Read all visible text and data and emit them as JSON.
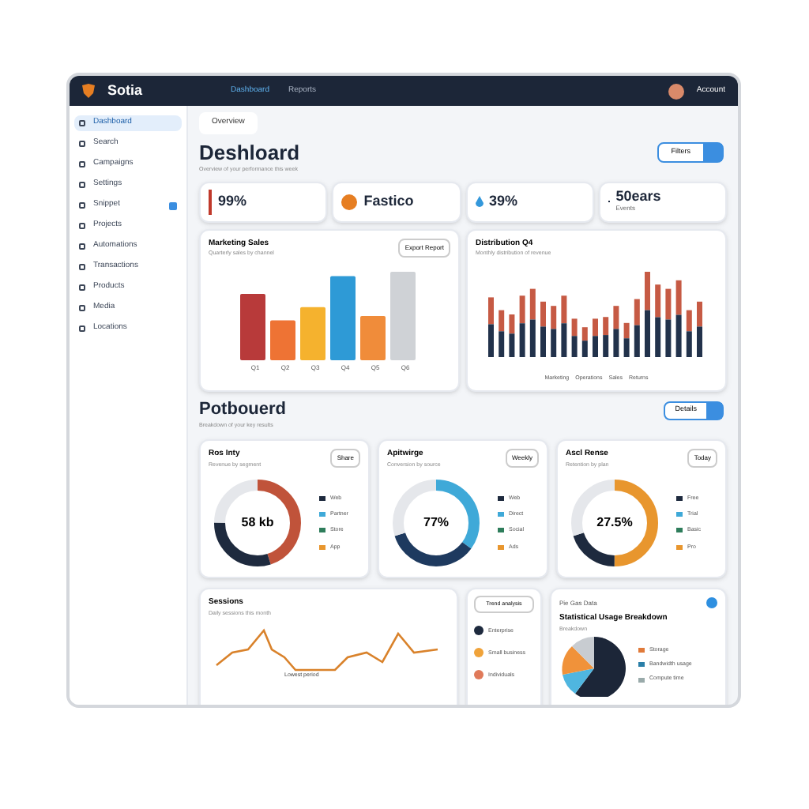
{
  "app": {
    "name": "Sotia"
  },
  "topnav": [
    {
      "label": "Dashboard",
      "selected": true
    },
    {
      "label": "Reports",
      "selected": false
    }
  ],
  "user": {
    "label": "Account"
  },
  "sidebar": {
    "items": [
      {
        "label": "Dashboard",
        "selected": true,
        "badge": false
      },
      {
        "label": "Search",
        "selected": false,
        "badge": false
      },
      {
        "label": "Campaigns",
        "selected": false,
        "badge": false
      },
      {
        "label": "Settings",
        "selected": false,
        "badge": false
      },
      {
        "label": "Snippet",
        "selected": false,
        "badge": true
      },
      {
        "label": "Projects",
        "selected": false,
        "badge": false
      },
      {
        "label": "Automations",
        "selected": false,
        "badge": false
      },
      {
        "label": "Transactions",
        "selected": false,
        "badge": false
      },
      {
        "label": "Products",
        "selected": false,
        "badge": false
      },
      {
        "label": "Media",
        "selected": false,
        "badge": false
      },
      {
        "label": "Locations",
        "selected": false,
        "badge": false
      }
    ]
  },
  "breadcrumb": "Overview",
  "header": {
    "title": "Deshloard",
    "subtitle": "Overview of your performance this week",
    "button": "Filters"
  },
  "stats": [
    {
      "value": "99%",
      "kind": "bar",
      "color": "#c0392b"
    },
    {
      "value": "Fastico",
      "kind": "logo",
      "color": "#e67e22"
    },
    {
      "value": "39%",
      "kind": "drop",
      "color": "#3498db"
    },
    {
      "value": "50ears",
      "caption": "Events",
      "kind": "plain",
      "color": "#1e2a3e"
    }
  ],
  "bar_card": {
    "title": "Marketing Sales",
    "subtitle": "Quarterly sales by channel",
    "button": "Export Report",
    "labels": [
      "Q1",
      "Q2",
      "Q3",
      "Q4",
      "Q5",
      "Q6"
    ]
  },
  "stack_card": {
    "title": "Distribution Q4",
    "subtitle": "Monthly distribution of revenue",
    "legend": [
      "Marketing",
      "Operations",
      "Sales",
      "Returns"
    ]
  },
  "section2": {
    "title": "Potbouerd",
    "subtitle": "Breakdown of your key results",
    "button": "Details"
  },
  "donuts": [
    {
      "title": "Ros Inty",
      "subtitle": "Revenue by segment",
      "value": "58 kb",
      "button": "Share",
      "legend": [
        "Web",
        "Partner",
        "Store",
        "App"
      ]
    },
    {
      "title": "Apitwirge",
      "subtitle": "Conversion by source",
      "value": "77%",
      "button": "Weekly",
      "legend": [
        "Web",
        "Direct",
        "Social",
        "Ads"
      ]
    },
    {
      "title": "Ascl Rense",
      "subtitle": "Retention by plan",
      "value": "27.5%",
      "button": "Today",
      "legend": [
        "Free",
        "Trial",
        "Basic",
        "Pro"
      ]
    }
  ],
  "line_card": {
    "title": "Sessions",
    "subtitle": "Daily sessions this month",
    "note": "Lowest period"
  },
  "legend_card": {
    "button": "Trend analysis",
    "items": [
      "Enterprise",
      "Small business",
      "Individuals"
    ]
  },
  "pie_card": {
    "header": "Pie Gas Data",
    "title": "Statistical Usage Breakdown",
    "subtitle": "Breakdown",
    "legend": [
      "Storage",
      "Bandwidth usage",
      "Compute time"
    ]
  }
}
